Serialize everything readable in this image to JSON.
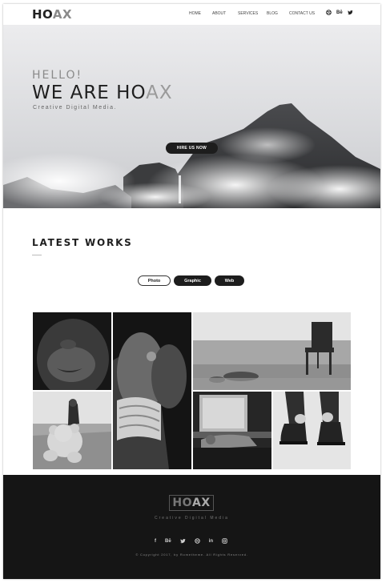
{
  "header": {
    "logo_ho": "HO",
    "logo_ax": "AX",
    "nav": [
      "HOME",
      "ABOUT",
      "SERVICES",
      "BLOG",
      "CONTACT US"
    ],
    "social_icons": [
      "dribbble-icon",
      "behance-icon",
      "twitter-icon"
    ]
  },
  "hero": {
    "hello": "HELLO!",
    "title_main": "WE ARE HO",
    "title_ax": "AX",
    "subtitle": "Creative Digital Media.",
    "cta": "HIRE US NOW"
  },
  "works": {
    "title": "LATEST WORKS",
    "filters": [
      "Photo",
      "Graphic",
      "Web"
    ],
    "gallery": [
      "portrait-photo",
      "hands-rope-photo",
      "beach-chair-photo",
      "girl-teddy-photo",
      "sleeping-window-photo",
      "boots-photo"
    ]
  },
  "footer": {
    "logo_ho": "HO",
    "logo_ax": "AX",
    "subtitle": "Creative Digital Media",
    "social_icons": [
      "facebook-icon",
      "behance-icon",
      "twitter-icon",
      "dribbble-icon",
      "linkedin-icon",
      "instagram-icon"
    ],
    "copyright": "© Copyright 2017, by Rometheme. All Rights Reserved."
  }
}
